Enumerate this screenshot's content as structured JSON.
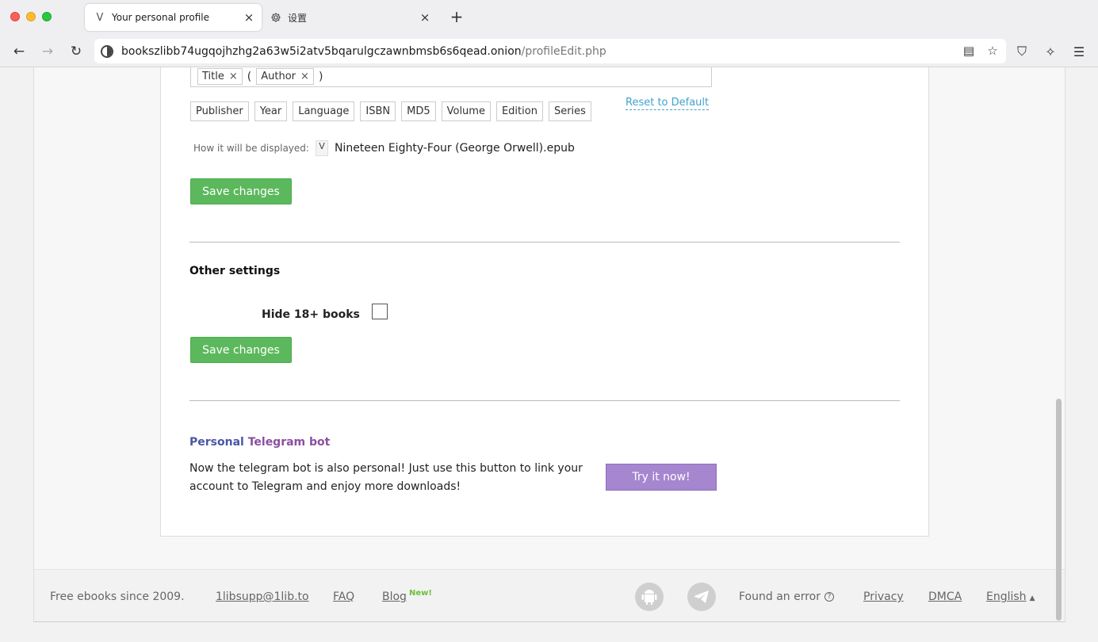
{
  "browser": {
    "tabs": [
      {
        "label": "Your personal profile",
        "icon": "library-v-icon"
      },
      {
        "label": "设置",
        "icon": "gear-icon"
      }
    ],
    "url_host": "bookszlibb74ugqojhzhg2a63w5i2atv5bqarulgczawnbmsb6s6qead.onion",
    "url_path": "/profileEdit.php"
  },
  "filename_format": {
    "tokens": [
      "Title",
      "Author"
    ],
    "fields": [
      "Publisher",
      "Year",
      "Language",
      "ISBN",
      "MD5",
      "Volume",
      "Edition",
      "Series"
    ],
    "reset_label": "Reset to Default",
    "display_label": "How it will be displayed:",
    "display_value": "Nineteen Eighty-Four (George Orwell).epub",
    "save_label": "Save changes"
  },
  "other_settings": {
    "title": "Other settings",
    "hide18_label": "Hide 18+ books",
    "hide18_checked": false,
    "save_label": "Save changes"
  },
  "telegram": {
    "title_part1": "Personal",
    "title_part2": "Telegram bot",
    "text": "Now the telegram bot is also personal! Just use this button to link your account to Telegram and enjoy more downloads!",
    "button_label": "Try it now!"
  },
  "footer": {
    "tagline": "Free ebooks since 2009.",
    "email": "1libsupp@1lib.to",
    "faq": "FAQ",
    "blog": "Blog",
    "blog_badge": "New!",
    "found_error": "Found an error",
    "privacy": "Privacy",
    "dmca": "DMCA",
    "language": "English"
  }
}
